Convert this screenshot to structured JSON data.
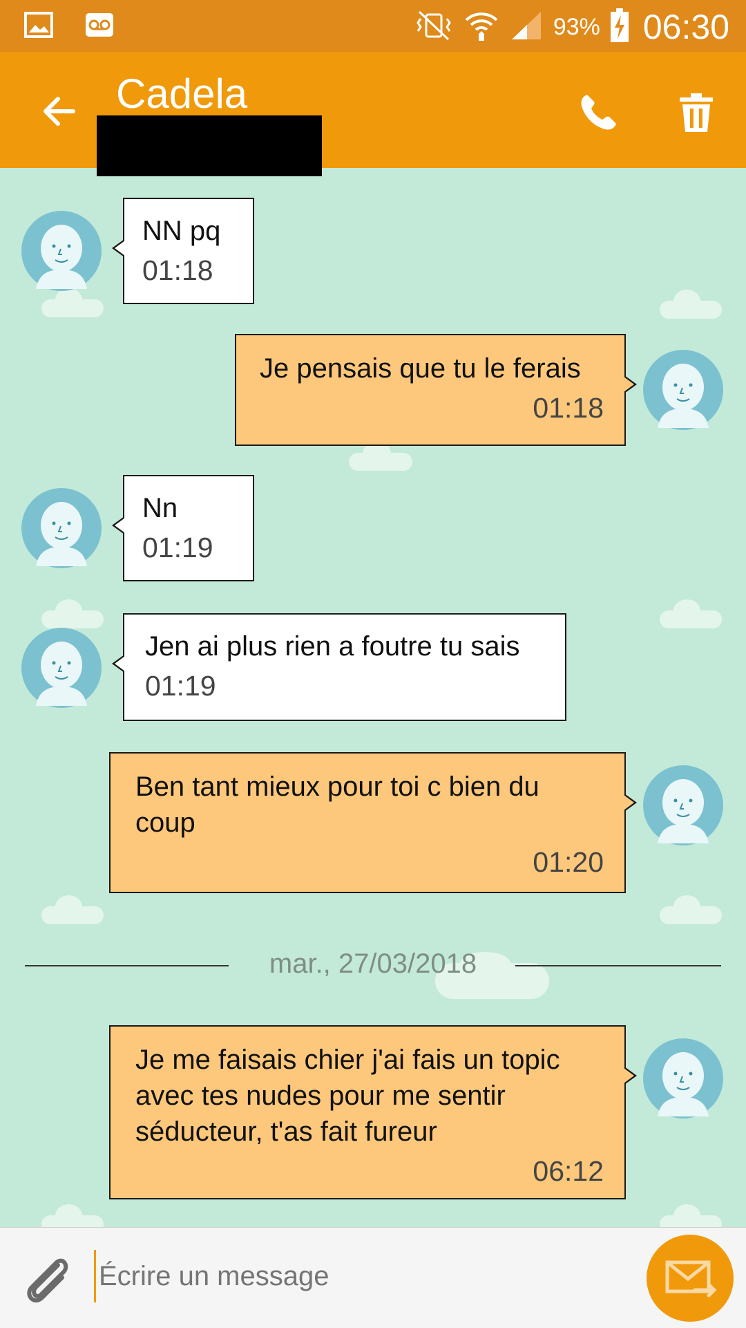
{
  "status_bar": {
    "battery_percent": "93%",
    "time": "06:30",
    "icons": [
      "gallery-icon",
      "voicemail-icon",
      "vibrate-icon",
      "wifi-icon",
      "signal-icon",
      "battery-charging-icon"
    ]
  },
  "app_bar": {
    "contact_name": "Cadela",
    "icons": [
      "back-arrow-icon",
      "phone-icon",
      "trash-icon"
    ]
  },
  "messages": [
    {
      "direction": "incoming",
      "text": "NN pq",
      "time": "01:18"
    },
    {
      "direction": "outgoing",
      "text": "Je pensais que tu le ferais",
      "time": "01:18"
    },
    {
      "direction": "incoming",
      "text": "Nn",
      "time": "01:19"
    },
    {
      "direction": "incoming",
      "text": "Jen ai plus rien a foutre tu sais",
      "time": "01:19"
    },
    {
      "direction": "outgoing",
      "text": "Ben tant mieux pour toi c bien du coup",
      "time": "01:20"
    },
    {
      "direction": "outgoing",
      "text": "Je me faisais chier j'ai fais un topic avec tes nudes pour me sentir séducteur, t'as fait fureur",
      "time": "06:12"
    }
  ],
  "date_separator": "mar., 27/03/2018",
  "compose": {
    "placeholder": "Écrire un message",
    "icons": [
      "paperclip-icon",
      "send-envelope-icon"
    ]
  },
  "colors": {
    "status_bar": "#df8a1a",
    "app_bar": "#f0990a",
    "chat_background": "#c3ead8",
    "incoming_bubble": "#ffffff",
    "outgoing_bubble": "#fdc87b",
    "avatar": "#7cc1cf"
  }
}
